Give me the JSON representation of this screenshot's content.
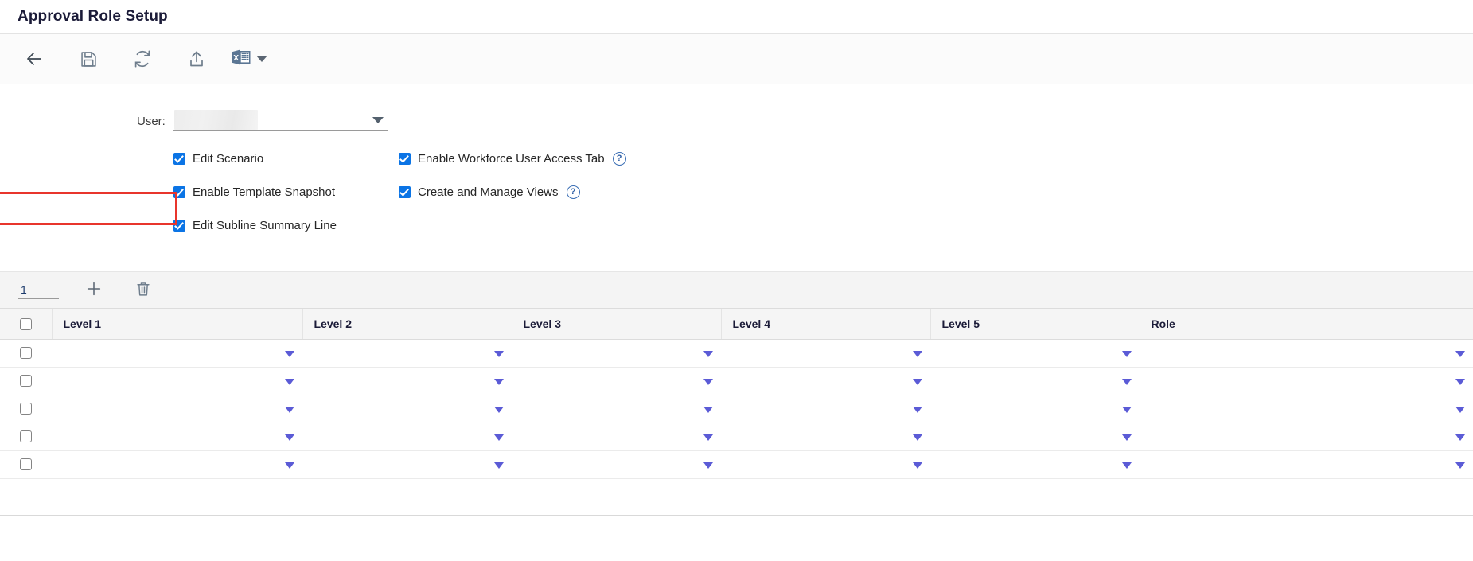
{
  "header": {
    "title": "Approval Role Setup"
  },
  "toolbar": {
    "back_label": "Back",
    "save_label": "Save",
    "refresh_label": "Refresh",
    "export_label": "Export",
    "excel_label": "Excel Export",
    "excel_glyph": "X"
  },
  "form": {
    "user_label": "User:",
    "user_value": "",
    "user_placeholder": ""
  },
  "permissions": {
    "left": [
      {
        "label": "Edit Scenario",
        "checked": true,
        "help": false
      },
      {
        "label": "Enable Template Snapshot",
        "checked": true,
        "help": false
      },
      {
        "label": "Edit Subline Summary Line",
        "checked": true,
        "help": false,
        "highlighted": true
      }
    ],
    "right": [
      {
        "label": "Enable Workforce User Access Tab",
        "checked": true,
        "help": true
      },
      {
        "label": "Create and Manage Views",
        "checked": true,
        "help": true
      }
    ],
    "help_glyph": "?",
    "annotation_color": "#e8352c"
  },
  "grid_toolbar": {
    "row_count_value": "1",
    "add_label": "Add Row",
    "delete_label": "Delete Row"
  },
  "table": {
    "columns": [
      "Level 1",
      "Level 2",
      "Level 3",
      "Level 4",
      "Level 5",
      "Role"
    ],
    "rows": [
      {
        "level1": "",
        "level2": "",
        "level3": "",
        "level4": "",
        "level5": "",
        "role": ""
      },
      {
        "level1": "",
        "level2": "",
        "level3": "",
        "level4": "",
        "level5": "",
        "role": ""
      },
      {
        "level1": "",
        "level2": "",
        "level3": "",
        "level4": "",
        "level5": "",
        "role": ""
      },
      {
        "level1": "",
        "level2": "",
        "level3": "",
        "level4": "",
        "level5": "",
        "role": ""
      },
      {
        "level1": "",
        "level2": "",
        "level3": "",
        "level4": "",
        "level5": "",
        "role": ""
      }
    ]
  },
  "colors": {
    "accent_blue": "#0b74e5",
    "caret_violet": "#5b5bd6",
    "header_text": "#1b1b38",
    "annotation_red": "#e8352c"
  }
}
